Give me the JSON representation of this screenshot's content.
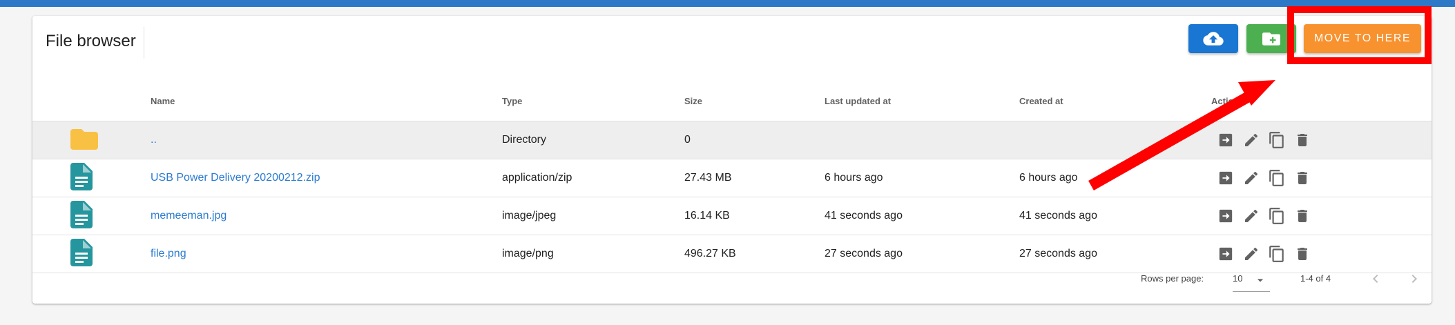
{
  "header": {
    "title": "File browser"
  },
  "toolbar": {
    "upload_icon": "cloud-upload-icon",
    "new_folder_icon": "folder-plus-icon",
    "move_label": "MOVE TO HERE"
  },
  "table": {
    "columns": [
      "Name",
      "Type",
      "Size",
      "Last updated at",
      "Created at",
      "Actions"
    ],
    "rows": [
      {
        "icon": "folder-icon",
        "name": "..",
        "type": "Directory",
        "size": "0",
        "updated": "",
        "created": "",
        "selected": true
      },
      {
        "icon": "file-document-icon",
        "name": "USB Power Delivery 20200212.zip",
        "type": "application/zip",
        "size": "27.43 MB",
        "updated": "6 hours ago",
        "created": "6 hours ago"
      },
      {
        "icon": "file-document-icon",
        "name": "memeeman.jpg",
        "type": "image/jpeg",
        "size": "16.14 KB",
        "updated": "41 seconds ago",
        "created": "41 seconds ago"
      },
      {
        "icon": "file-document-icon",
        "name": "file.png",
        "type": "image/png",
        "size": "496.27 KB",
        "updated": "27 seconds ago",
        "created": "27 seconds ago"
      }
    ],
    "row_actions": [
      "move-icon",
      "edit-icon",
      "copy-icon",
      "delete-icon"
    ]
  },
  "footer": {
    "rows_per_page_label": "Rows per page:",
    "rows_per_page_value": "10",
    "range": "1-4 of 4"
  },
  "colors": {
    "topbar": "#2d79c7",
    "upload": "#1976d2",
    "new_folder": "#4caf50",
    "move": "#f7922f",
    "annotation": "#ff0000",
    "folder": "#f8c144",
    "file": "#26969e",
    "link": "#2a7bd0"
  }
}
